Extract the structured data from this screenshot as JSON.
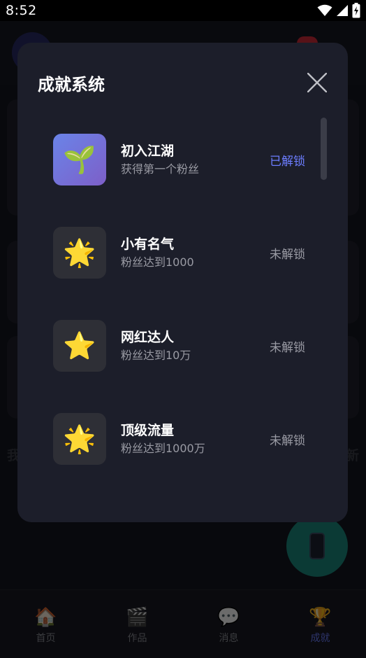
{
  "status_bar": {
    "time": "8:52",
    "icons": [
      "wifi-icon",
      "signal-icon",
      "battery-charging-icon"
    ]
  },
  "background": {
    "left_text": "我",
    "right_text": "新",
    "bottom_nav": [
      {
        "label": "首页",
        "icon": "home-icon",
        "glyph": "🏠",
        "active": false
      },
      {
        "label": "作品",
        "icon": "works-icon",
        "glyph": "🎬",
        "active": false
      },
      {
        "label": "消息",
        "icon": "message-icon",
        "glyph": "💬",
        "active": false
      },
      {
        "label": "成就",
        "icon": "trophy-icon",
        "glyph": "🏆",
        "active": true
      }
    ],
    "fab_icon": "phone-icon"
  },
  "dialog": {
    "title": "成就系统",
    "close_icon": "close-icon",
    "achievements": [
      {
        "name": "初入江湖",
        "description": "获得第一个粉丝",
        "status": "已解锁",
        "unlocked": true,
        "icon": "seedling-icon",
        "glyph": "🌱"
      },
      {
        "name": "小有名气",
        "description": "粉丝达到1000",
        "status": "未解锁",
        "unlocked": false,
        "icon": "sparkle-star-icon",
        "glyph": "🌟"
      },
      {
        "name": "网红达人",
        "description": "粉丝达到10万",
        "status": "未解锁",
        "unlocked": false,
        "icon": "star-icon",
        "glyph": "⭐"
      },
      {
        "name": "顶级流量",
        "description": "粉丝达到1000万",
        "status": "未解锁",
        "unlocked": false,
        "icon": "sparkle-star-icon",
        "glyph": "🌟"
      }
    ]
  },
  "colors": {
    "accent": "#6c7dff",
    "dialog_bg": "#1c1e2a",
    "unlocked_icon_gradient": [
      "#6a84e8",
      "#7d5fc8"
    ],
    "fab": "#1c8a7e"
  }
}
